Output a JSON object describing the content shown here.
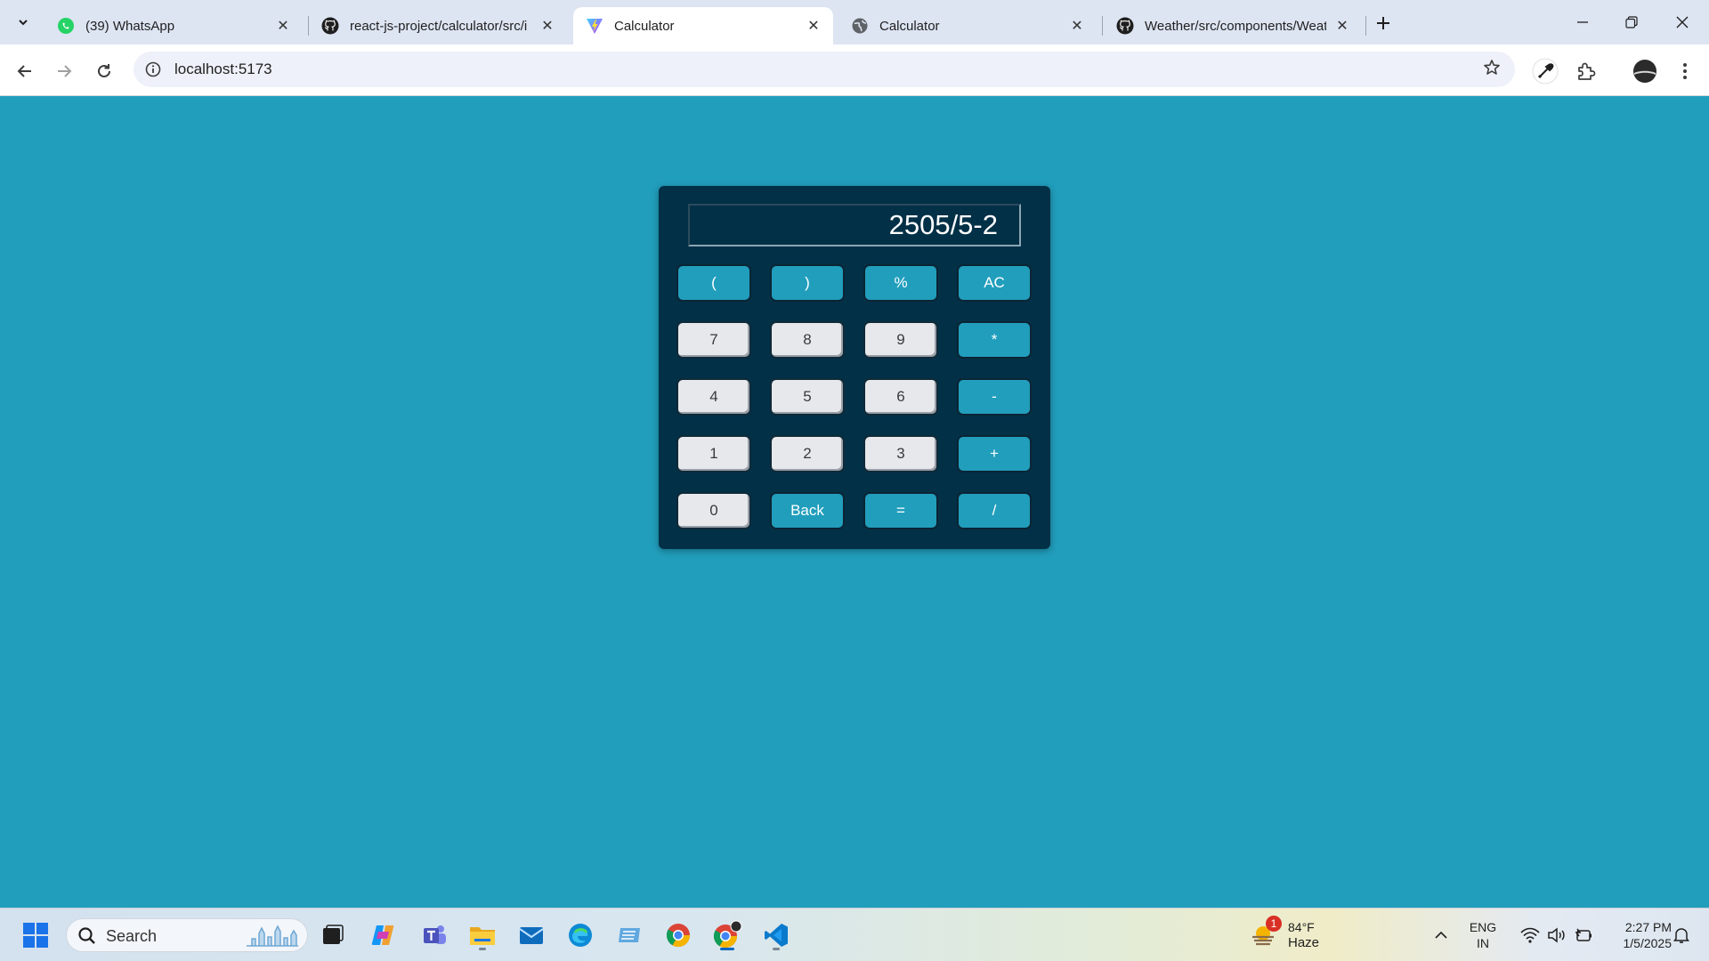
{
  "browser": {
    "tabs": [
      {
        "title": "(39) WhatsApp",
        "icon": "whatsapp-icon",
        "active": false
      },
      {
        "title": "react-js-project/calculator/src/i",
        "icon": "github-icon",
        "active": false
      },
      {
        "title": "Calculator",
        "icon": "vite-icon",
        "active": true
      },
      {
        "title": "Calculator",
        "icon": "globe-icon",
        "active": false
      },
      {
        "title": "Weather/src/components/Weat",
        "icon": "github-icon",
        "active": false
      }
    ],
    "address": "localhost:5173"
  },
  "calculator": {
    "display": "2505/5-2",
    "keys": [
      [
        "(",
        ")",
        "%",
        "AC"
      ],
      [
        "7",
        "8",
        "9",
        "*"
      ],
      [
        "4",
        "5",
        "6",
        "-"
      ],
      [
        "1",
        "2",
        "3",
        "+"
      ],
      [
        "0",
        "Back",
        "=",
        "/"
      ]
    ]
  },
  "taskbar": {
    "search_label": "Search",
    "weather": {
      "temp": "84°F",
      "condition": "Haze",
      "badge": "1"
    },
    "language": {
      "line1": "ENG",
      "line2": "IN"
    },
    "clock": {
      "time": "2:27 PM",
      "date": "1/5/2025"
    }
  },
  "colors": {
    "page_bg": "#219EBC",
    "calc_bg": "#023047",
    "op_key": "#219EBC",
    "num_key": "#E6E8EC"
  }
}
